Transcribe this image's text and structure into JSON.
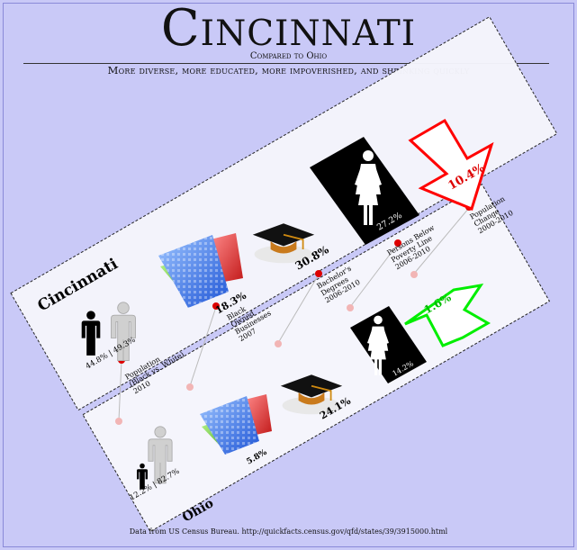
{
  "header": {
    "title": "Cincinnati",
    "subtitle": "Compared to Ohio",
    "tagline": "More diverse, more educated, more impoverished, and shrinking quickly"
  },
  "footer": {
    "source": "Data from US Census Bureau.  http://quickfacts.census.gov/qfd/states/39/3915000.html"
  },
  "cincinnati": {
    "name": "Cincinnati",
    "population_split": "44.8% | 49.3%",
    "black_owned_pct": "18.3%",
    "bachelors_pct": "30.8%",
    "poverty_pct": "27.2%",
    "pop_change_pct": "10.4%"
  },
  "ohio": {
    "name": "Ohio",
    "population_split": "12.2% | 82.7%",
    "black_owned_pct": "5.8%",
    "bachelors_pct": "24.1%",
    "poverty_pct": "14.2%",
    "pop_change_pct": "1.6%"
  },
  "metrics": [
    {
      "lines": [
        "Population",
        "(Black vs. White)",
        "2010"
      ]
    },
    {
      "lines": [
        "Black",
        "Owned",
        "Businesses",
        "2007"
      ]
    },
    {
      "lines": [
        "Bachelor's",
        "Degrees",
        "2006-2010"
      ]
    },
    {
      "lines": [
        "Persons Below",
        "Poverty Line",
        "2006-2010"
      ]
    },
    {
      "lines": [
        "Population",
        "Change",
        "2000-2010"
      ]
    }
  ],
  "colors": {
    "background": "#c9c9f7",
    "decrease_arrow": "#ff0000",
    "increase_arrow": "#00ee00",
    "marker": "#dd0000"
  }
}
